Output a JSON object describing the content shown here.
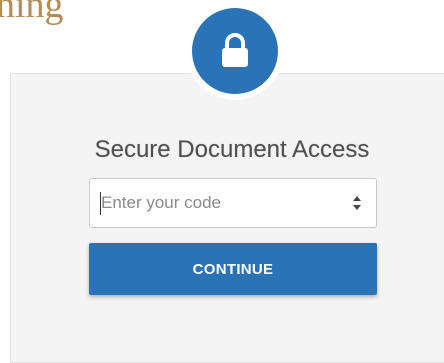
{
  "background": {
    "heading_fragment": "ning"
  },
  "form": {
    "title": "Secure Document Access",
    "code_input": {
      "value": "",
      "placeholder": "Enter your code"
    },
    "continue_label": "CONTINUE"
  },
  "icons": {
    "lock": "lock-icon",
    "spinner": "spinner-arrows-icon"
  },
  "colors": {
    "accent": "#2a73b7",
    "card_background": "#f4f4f4",
    "heading_gold": "#b58d54",
    "title_text": "#505050"
  }
}
